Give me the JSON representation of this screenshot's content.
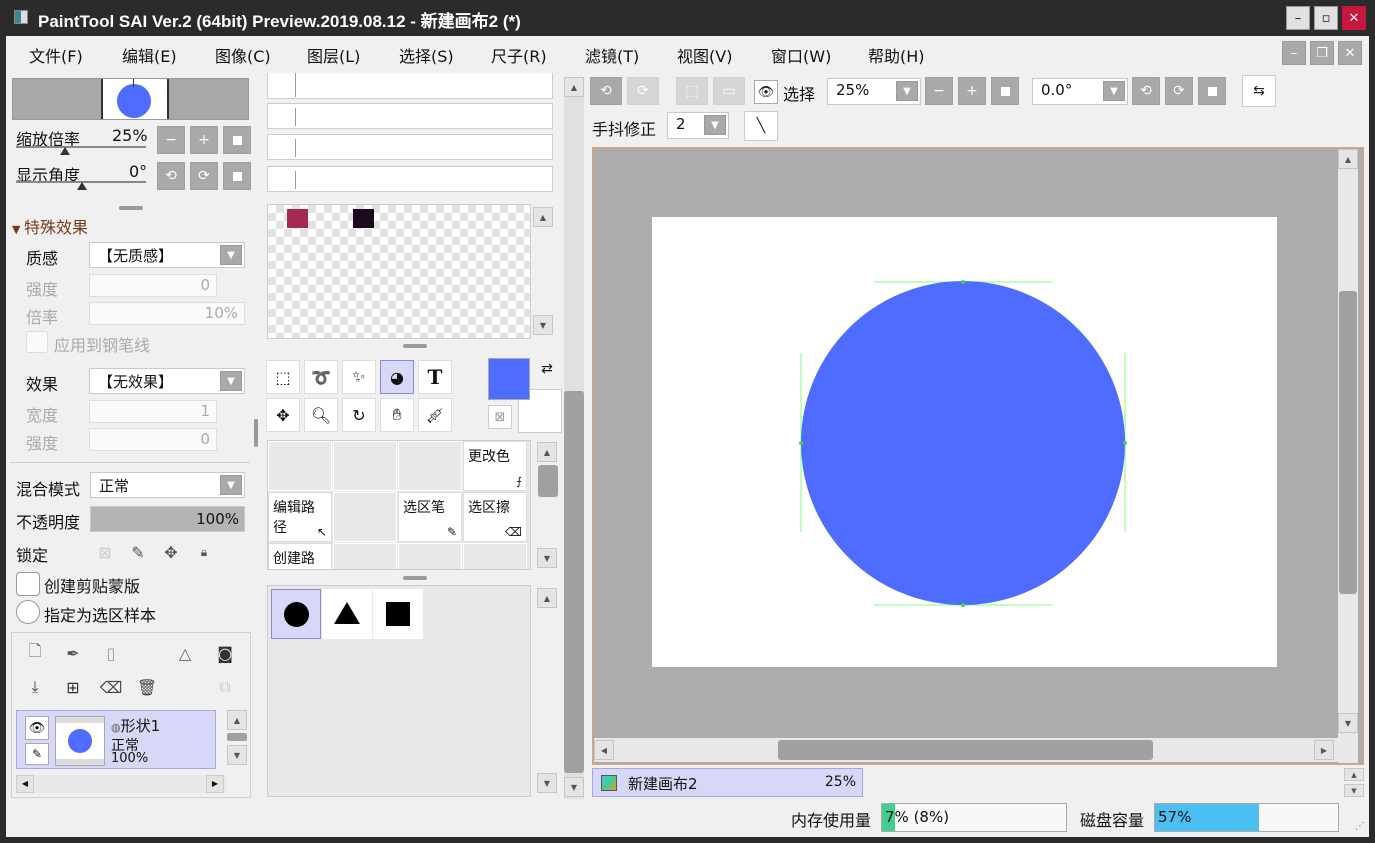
{
  "window": {
    "title": "PaintTool SAI Ver.2 (64bit) Preview.2019.08.12 - 新建画布2 (*)",
    "minimize": "–",
    "maximize": "▫",
    "close": "✕"
  },
  "menu": [
    "文件(F)",
    "编辑(E)",
    "图像(C)",
    "图层(L)",
    "选择(S)",
    "尺子(R)",
    "滤镜(T)",
    "视图(V)",
    "窗口(W)",
    "帮助(H)"
  ],
  "navigator": {
    "zoom_label": "缩放倍率",
    "zoom_value": "25%",
    "angle_label": "显示角度",
    "angle_value": "0°"
  },
  "effects": {
    "section_title": "特殊效果",
    "texture_label": "质感",
    "texture_value": "【无质感】",
    "strength_label": "强度",
    "strength_value": "0",
    "rate_label": "倍率",
    "rate_value": "10%",
    "apply_pen_label": "应用到钢笔线",
    "effect_label": "效果",
    "effect_value": "【无效果】",
    "width_label": "宽度",
    "width_value": "1",
    "strength2_label": "强度",
    "strength2_value": "0"
  },
  "layer_props": {
    "blend_label": "混合模式",
    "blend_value": "正常",
    "opacity_label": "不透明度",
    "opacity_value": "100%",
    "opacity_fraction": 1.0,
    "lock_label": "锁定",
    "clip_label": "创建剪贴蒙版",
    "sample_label": "指定为选区样本"
  },
  "layer": {
    "name": "形状1",
    "mode": "正常",
    "opacity": "100%"
  },
  "swatches": {
    "colors": [
      "#a52a55",
      "#1e0a1e"
    ]
  },
  "tools": {
    "text_tool_glyph": "T"
  },
  "colors": {
    "primary": "#4e6cff",
    "secondary": "#ffffff"
  },
  "tool_grid": {
    "change_color": "更改色",
    "edit_path": "编辑路径",
    "sel_pen": "选区笔",
    "sel_erase": "选区擦",
    "create_path": "创建路径"
  },
  "shapes": [
    "circle",
    "triangle",
    "square"
  ],
  "toolbar": {
    "select_label": "选择",
    "zoom_value": "25%",
    "angle_value": "0.0°",
    "stabilizer_label": "手抖修正",
    "stabilizer_value": "2"
  },
  "canvas_tab": {
    "name": "新建画布2",
    "zoom": "25%"
  },
  "status": {
    "memory_label": "内存使用量",
    "memory_value": "7% (8%)",
    "memory_fraction": 0.07,
    "disk_label": "磁盘容量",
    "disk_value": "57%",
    "disk_fraction": 0.57
  },
  "accent_colors": {
    "circle": "#4e6cff",
    "guide": "#7dff7d",
    "memory_bar": "#3fcf8e",
    "disk_bar": "#4bbef2"
  }
}
